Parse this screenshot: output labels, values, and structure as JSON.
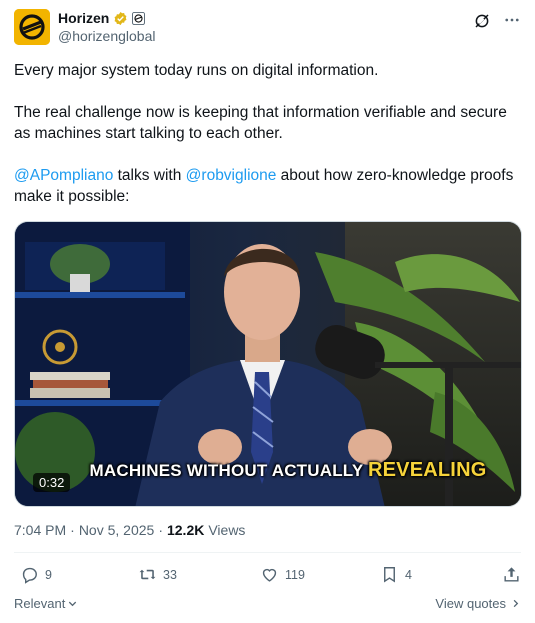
{
  "author": {
    "display_name": "Horizen",
    "handle": "@horizenglobal",
    "verified_color": "#e2b719"
  },
  "post": {
    "line1": "Every major system today runs on digital information.",
    "line2": "The real challenge now is keeping that information verifiable and secure as machines start talking to each other.",
    "mention1": "@APompliano",
    "text_mid": " talks with ",
    "mention2": "@robviglione",
    "text_end": " about how zero-knowledge proofs make it possible:"
  },
  "video": {
    "caption_main": "MACHINES WITHOUT ACTUALLY ",
    "caption_highlight": "REVEALING",
    "duration": "0:32"
  },
  "meta": {
    "time": "7:04 PM",
    "sep1": "·",
    "date": "Nov 5, 2025",
    "sep2": "·",
    "views_count": "12.2K",
    "views_label": "Views"
  },
  "actions": {
    "replies": "9",
    "reposts": "33",
    "likes": "119",
    "bookmarks": "4"
  },
  "footer": {
    "sort_label": "Relevant",
    "view_quotes_label": "View quotes"
  },
  "colors": {
    "accent": "#1d9bf0",
    "muted": "#536471",
    "brand_yellow": "#f2b400"
  }
}
